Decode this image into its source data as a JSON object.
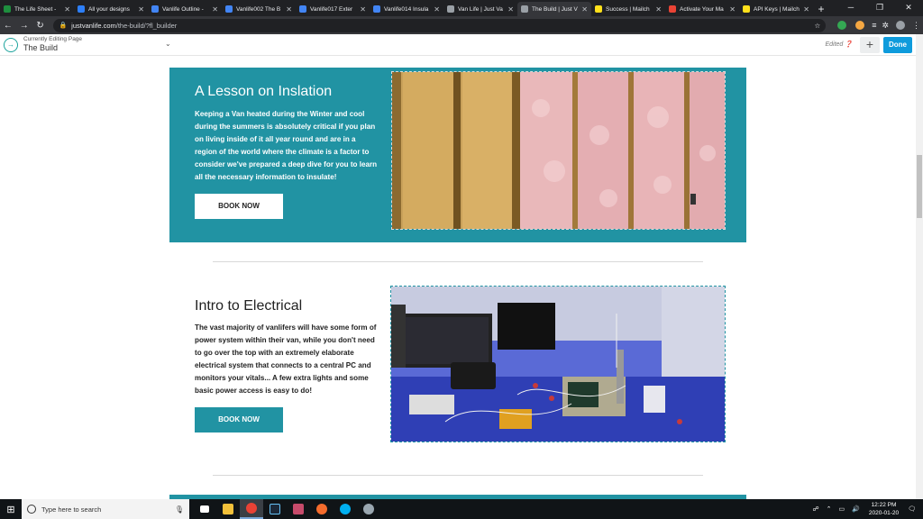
{
  "browser": {
    "tabs": [
      {
        "title": "The Life Sheet - ",
        "color": "#1e8e3e",
        "active": false
      },
      {
        "title": "All your designs",
        "color": "#2d7ff9",
        "active": false
      },
      {
        "title": "Vanlife Outline -",
        "color": "#4285f4",
        "active": false
      },
      {
        "title": "Vanlife002 The B",
        "color": "#4285f4",
        "active": false
      },
      {
        "title": "Vanlife017 Exter",
        "color": "#4285f4",
        "active": false
      },
      {
        "title": "Vanlife014 Insula",
        "color": "#4285f4",
        "active": false
      },
      {
        "title": "Van Life | Just Va",
        "color": "#9aa0a6",
        "active": false
      },
      {
        "title": "The Build | Just V",
        "color": "#9aa0a6",
        "active": true
      },
      {
        "title": "Success | Mailch",
        "color": "#ffe01b",
        "active": false
      },
      {
        "title": "Activate Your Ma",
        "color": "#ea4335",
        "active": false
      },
      {
        "title": "API Keys | Mailch",
        "color": "#ffe01b",
        "active": false
      }
    ],
    "url_domain": "justvanlife.com",
    "url_path": "/the-build/?fl_builder"
  },
  "builder": {
    "editing_label": "Currently Editing Page",
    "page_name": "The Build",
    "edited_label": "Edited",
    "done_label": "Done"
  },
  "section_insulation": {
    "title": "A Lesson on Inslation",
    "body": "Keeping a Van heated during the Winter and cool during the summers is absolutely critical if you plan on living inside of it all year round and are in a region of the world where the climate is a factor to consider we've prepared a deep dive for you to learn all the necessary information to insulate!",
    "button": "BOOK NOW"
  },
  "section_electrical": {
    "title": "Intro to Electrical",
    "body": "The vast majority of vanlifers will have some form of power system within their van, while you don't need to go over the top with an extremely elaborate electrical system that connects to a central PC and monitors your vitals... A few extra lights and some basic power access is easy to do!",
    "button": "BOOK NOW"
  },
  "taskbar": {
    "search_placeholder": "Type here to search",
    "time": "12:22 PM",
    "date": "2020-01-20"
  },
  "colors": {
    "teal": "#2193a3",
    "done_blue": "#0e9bdc"
  }
}
